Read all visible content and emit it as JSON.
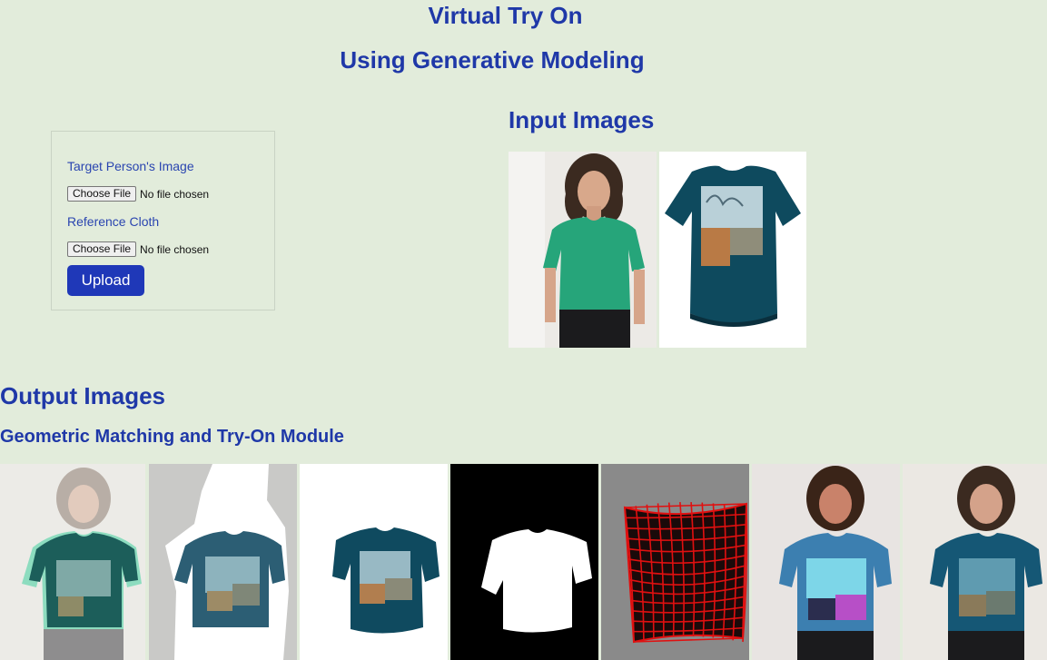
{
  "header": {
    "title": "Virtual Try On",
    "subtitle": "Using Generative Modeling"
  },
  "form": {
    "target_label": "Target Person's Image",
    "reference_label": "Reference Cloth",
    "choose_file_label": "Choose File",
    "no_file_text": "No file chosen",
    "upload_label": "Upload"
  },
  "input_section": {
    "heading": "Input Images",
    "images": [
      "person-photo",
      "tshirt-photo"
    ]
  },
  "output_section": {
    "heading": "Output Images",
    "module_heading": "Geometric Matching and Try-On Module",
    "images": [
      "overlay",
      "segmentation-overlay",
      "warped-cloth",
      "cloth-mask",
      "warp-grid",
      "try-on-rendered",
      "try-on-final"
    ]
  },
  "colors": {
    "background": "#e2ecdb",
    "accent": "#1f38a8",
    "button": "#1f38b8",
    "shirt_green": "#26a57a",
    "shirt_teal": "#0e4a5e"
  }
}
